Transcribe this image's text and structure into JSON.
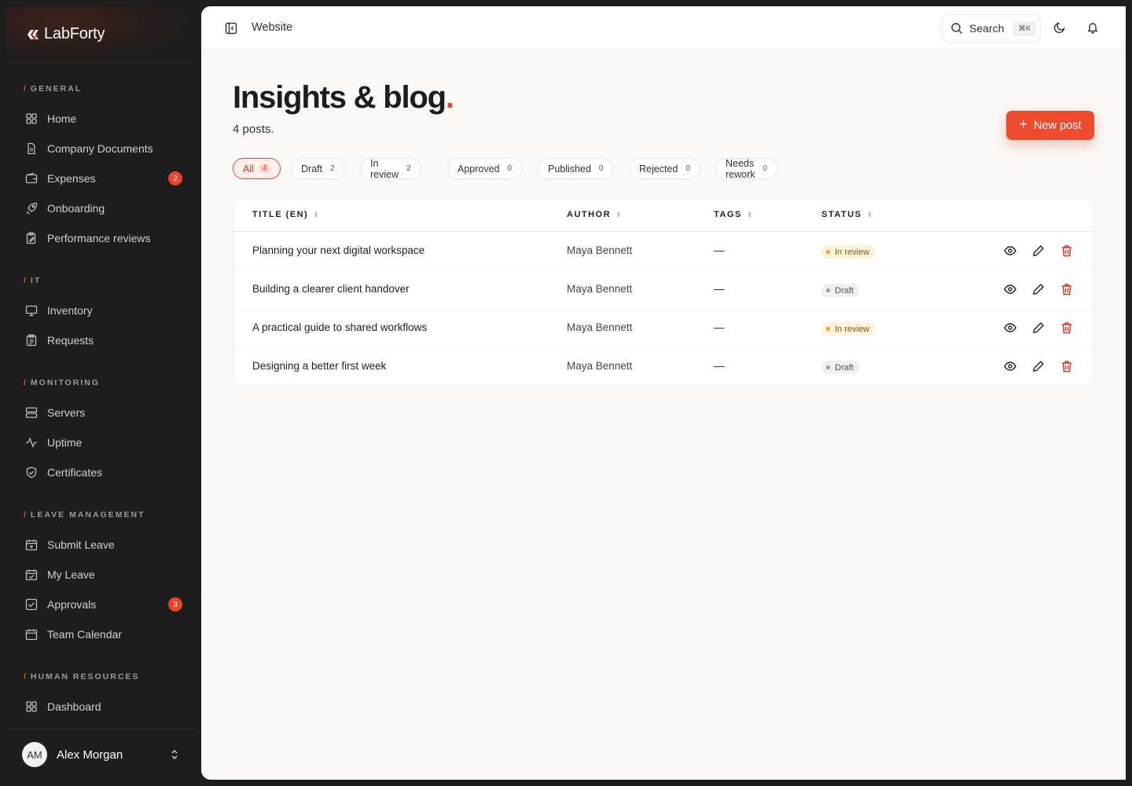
{
  "brand": {
    "name": "LabForty"
  },
  "sidebar": {
    "sections": [
      {
        "title": "GENERAL",
        "items": [
          {
            "label": "Home",
            "icon": "grid-icon"
          },
          {
            "label": "Company Documents",
            "icon": "document-icon"
          },
          {
            "label": "Expenses",
            "icon": "wallet-icon",
            "badge": "2"
          },
          {
            "label": "Onboarding",
            "icon": "rocket-icon"
          },
          {
            "label": "Performance reviews",
            "icon": "clipboard-edit-icon"
          }
        ]
      },
      {
        "title": "IT",
        "items": [
          {
            "label": "Inventory",
            "icon": "monitor-icon"
          },
          {
            "label": "Requests",
            "icon": "clipboard-list-icon"
          }
        ]
      },
      {
        "title": "MONITORING",
        "items": [
          {
            "label": "Servers",
            "icon": "server-icon"
          },
          {
            "label": "Uptime",
            "icon": "activity-icon"
          },
          {
            "label": "Certificates",
            "icon": "shield-check-icon"
          }
        ]
      },
      {
        "title": "LEAVE MANAGEMENT",
        "items": [
          {
            "label": "Submit Leave",
            "icon": "calendar-plus-icon"
          },
          {
            "label": "My Leave",
            "icon": "calendar-check-icon"
          },
          {
            "label": "Approvals",
            "icon": "check-square-icon",
            "badge": "3"
          },
          {
            "label": "Team Calendar",
            "icon": "calendar-icon"
          }
        ]
      },
      {
        "title": "HUMAN RESOURCES",
        "items": [
          {
            "label": "Dashboard",
            "icon": "grid-icon"
          }
        ]
      }
    ],
    "user": {
      "initials": "AM",
      "name": "Alex Morgan"
    }
  },
  "topbar": {
    "breadcrumb": "Website",
    "search_label": "Search",
    "search_shortcut": "⌘K"
  },
  "page": {
    "title": "Insights & blog",
    "title_dot": ".",
    "subtitle": "4 posts.",
    "new_post_label": "New post"
  },
  "filters": [
    {
      "label": "All",
      "count": "4",
      "active": true
    },
    {
      "label": "Draft",
      "count": "2"
    },
    {
      "label": "In review",
      "count": "2"
    },
    {
      "label": "Approved",
      "count": "0"
    },
    {
      "label": "Published",
      "count": "0"
    },
    {
      "label": "Rejected",
      "count": "0"
    },
    {
      "label": "Needs rework",
      "count": "0"
    }
  ],
  "table": {
    "columns": [
      "TITLE (EN)",
      "AUTHOR",
      "TAGS",
      "STATUS"
    ],
    "rows": [
      {
        "title": "Planning your next digital workspace",
        "author": "Maya Bennett",
        "tags": "—",
        "status": "In review"
      },
      {
        "title": "Building a clearer client handover",
        "author": "Maya Bennett",
        "tags": "—",
        "status": "Draft"
      },
      {
        "title": "A practical guide to shared workflows",
        "author": "Maya Bennett",
        "tags": "—",
        "status": "In review"
      },
      {
        "title": "Designing a better first week",
        "author": "Maya Bennett",
        "tags": "—",
        "status": "Draft"
      }
    ]
  },
  "colors": {
    "accent": "#ee4a2e",
    "sidebar_bg": "#1d1d1d",
    "review": "#f2a11d",
    "delete": "#d92d20"
  }
}
